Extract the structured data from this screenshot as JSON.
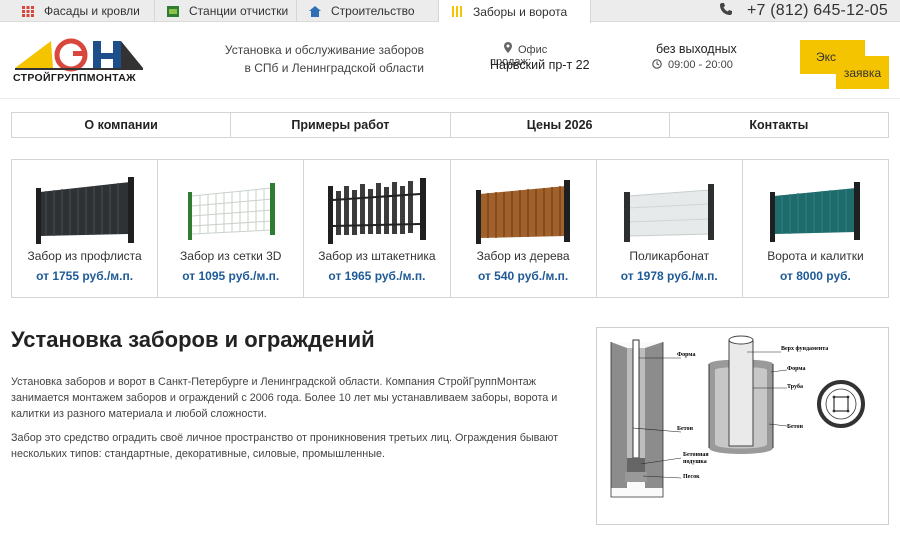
{
  "topbar": {
    "tabs": [
      {
        "label": "Фасады и кровли",
        "icon": "grid-icon",
        "active": false
      },
      {
        "label": "Станции отчистки",
        "icon": "station-icon",
        "active": false
      },
      {
        "label": "Строительство",
        "icon": "house-icon",
        "active": false
      },
      {
        "label": "Заборы и ворота",
        "icon": "fence-icon",
        "active": true
      }
    ],
    "phone": "+7 (812) 645-12-05"
  },
  "header": {
    "logo_text": "СТРОЙГРУППМОНТАЖ",
    "slogan_line1": "Установка и обслуживание заборов",
    "slogan_line2": "в СПб и Ленинградской области",
    "office_label": "Офис продаж:",
    "office_address": "Нарвский пр-т 22",
    "hours_label": "без выходных",
    "hours_time": "09:00 - 20:00",
    "cta_text1": "Экс",
    "cta_text2": "заявка"
  },
  "nav": [
    {
      "label": "О компании"
    },
    {
      "label": "Примеры работ"
    },
    {
      "label": "Цены 2026"
    },
    {
      "label": "Контакты"
    }
  ],
  "products": [
    {
      "name": "Забор из профлиста",
      "price": "от 1755 руб./м.п.",
      "color": "#3a3d40"
    },
    {
      "name": "Забор из сетки 3D",
      "price": "от 1095 руб./м.п.",
      "color": "#2f7d32"
    },
    {
      "name": "Забор из штакетника",
      "price": "от 1965 руб./м.п.",
      "color": "#3b3b3b"
    },
    {
      "name": "Забор из дерева",
      "price": "от 540 руб./м.п.",
      "color": "#a0612b"
    },
    {
      "name": "Поликарбонат",
      "price": "от 1978 руб./м.п.",
      "color": "#e9ecec"
    },
    {
      "name": "Ворота и калитки",
      "price": "от 8000 руб.",
      "color": "#1f6a6a"
    }
  ],
  "main": {
    "title": "Установка заборов и ограждений",
    "p1_line1": "Установка заборов и ворот в Санкт-Петербурге и Ленинградской области. Компания СтройГруппМонтаж",
    "p1_line2": "занимается монтажем заборов и ограждений с 2006 года. Более 10 лет мы устанавливаем заборы, ворота и",
    "p1_line3": "калитки из разного материала и любой сложности.",
    "p2_line1": "Забор это средство оградить своё личное пространство от проникновения третьих лиц. Ограждения бывают",
    "p2_line2": "нескольких типов: стандартные, декоративные, силовые, промышленные."
  },
  "diagram": {
    "labels": {
      "forma_left": "Форма",
      "beton_left": "Бетон",
      "podushka1": "Бетонная",
      "podushka2": "подушка",
      "pesok": "Песок",
      "verh": "Верх фундамента",
      "forma_right": "Форма",
      "truba": "Труба",
      "beton_right": "Бетон"
    }
  },
  "colors": {
    "accent_yellow": "#f5c400",
    "price_blue": "#1e5a96",
    "topbar_bg": "#ececec"
  }
}
